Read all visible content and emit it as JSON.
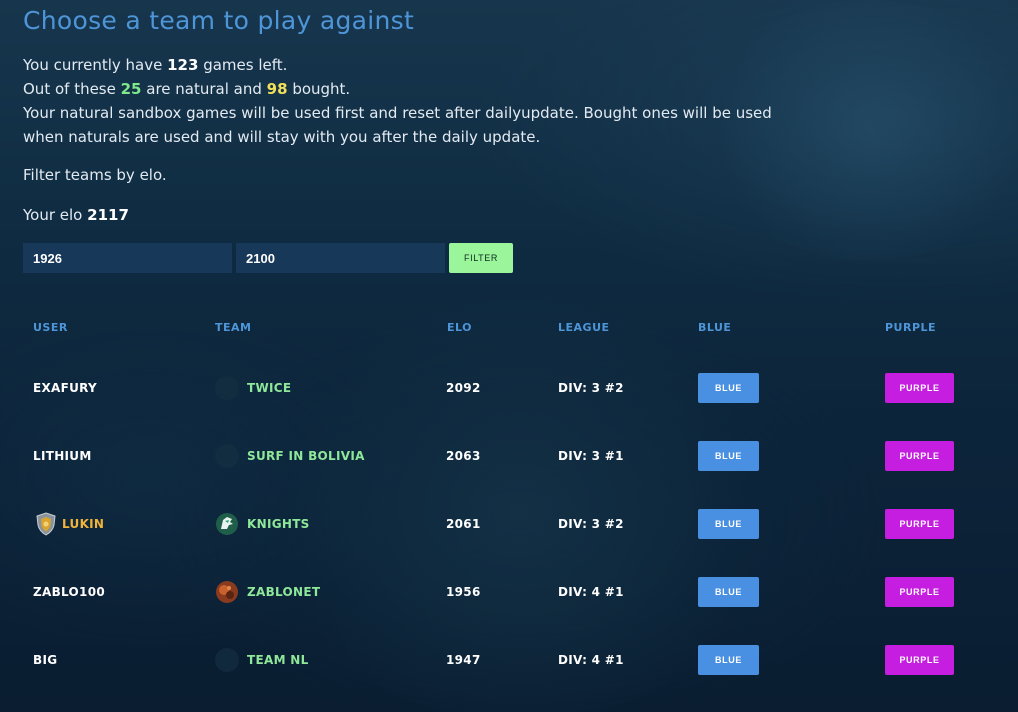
{
  "header": {
    "title": "Choose a team to play against"
  },
  "info": {
    "line1_prefix": "You currently have ",
    "games_left": "123",
    "line1_suffix": " games left.",
    "line2_prefix": "Out of these ",
    "natural": "25",
    "line2_middle": " are natural and ",
    "bought": "98",
    "line2_suffix": " bought.",
    "line3": "Your natural sandbox games will be used first and reset after dailyupdate. Bought ones will be used when naturals are used and will stay with you after the daily update."
  },
  "filter": {
    "label": "Filter teams by elo.",
    "your_elo_label": "Your elo ",
    "your_elo": "2117",
    "min_value": "1926",
    "max_value": "2100",
    "button_label": "FILTER"
  },
  "table": {
    "columns": [
      "USER",
      "TEAM",
      "ELO",
      "LEAGUE",
      "BLUE",
      "PURPLE"
    ],
    "rows": [
      {
        "user": "EXAFURY",
        "team": "TWICE",
        "elo": "2092",
        "league": "DIV: 3 #2",
        "blue": "BLUE",
        "purple": "PURPLE",
        "user_icon": "",
        "team_icon": "blank-avatar-icon"
      },
      {
        "user": "LITHIUM",
        "team": "SURF IN BOLIVIA",
        "elo": "2063",
        "league": "DIV: 3 #1",
        "blue": "BLUE",
        "purple": "PURPLE",
        "user_icon": "",
        "team_icon": "blank-avatar-icon"
      },
      {
        "user": "LUKIN",
        "team": "KNIGHTS",
        "elo": "2061",
        "league": "DIV: 3 #2",
        "blue": "BLUE",
        "purple": "PURPLE",
        "user_icon": "shield-rank-icon",
        "team_icon": "knight-logo-icon"
      },
      {
        "user": "ZABLO100",
        "team": "ZABLONET",
        "elo": "1956",
        "league": "DIV: 4 #1",
        "blue": "BLUE",
        "purple": "PURPLE",
        "user_icon": "",
        "team_icon": "zablonet-logo-icon"
      },
      {
        "user": "BIG",
        "team": "TEAM NL",
        "elo": "1947",
        "league": "DIV: 4 #1",
        "blue": "BLUE",
        "purple": "PURPLE",
        "user_icon": "",
        "team_icon": "blank-avatar-icon"
      }
    ]
  },
  "colors": {
    "title": "#4e95d8",
    "natural": "#7ee88a",
    "bought": "#f1e05a",
    "team_text": "#8fe89a",
    "highlight_user": "#f0b43a",
    "blue_button": "#4a90e2",
    "purple_button": "#c51ee0",
    "filter_button": "#9bf59b"
  }
}
